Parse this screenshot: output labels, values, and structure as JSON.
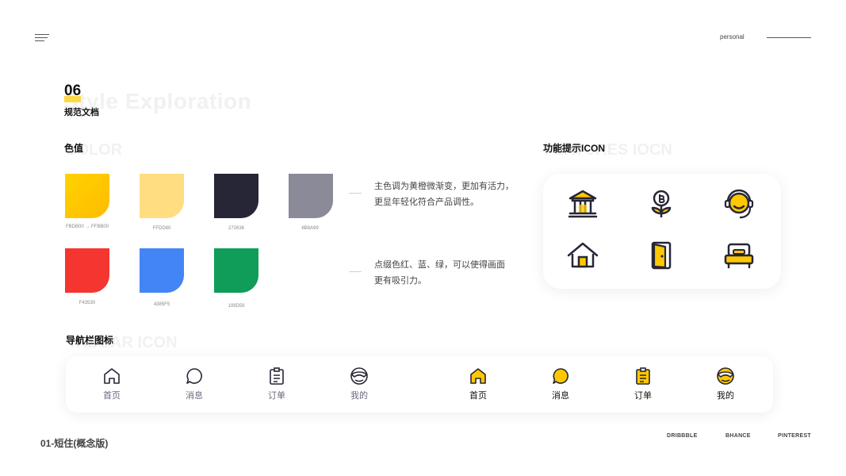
{
  "header": {
    "personal_label": "personal"
  },
  "section": {
    "number": "06",
    "ghost_title": "Style Exploration",
    "title": "规范文档"
  },
  "color": {
    "heading": "色值",
    "ghost": "COLOR",
    "swatches": [
      {
        "label": "FBDB00 → FFBB00",
        "gradient": [
          "#FFD300",
          "#FFBB00"
        ]
      },
      {
        "label": "FFDD80",
        "color": "#FFDD80"
      },
      {
        "label": "272636",
        "color": "#272636"
      },
      {
        "label": "8B8A99",
        "color": "#8B8A99"
      },
      {
        "label": "F43530",
        "color": "#F43530"
      },
      {
        "label": "4385F5",
        "color": "#4385F5"
      },
      {
        "label": "109D59",
        "color": "#109D59"
      }
    ],
    "desc_primary": [
      "主色调为黄橙微渐变，更加有活力，",
      "更显年轻化符合产品调性。"
    ],
    "desc_accent": [
      "点缀色红、蓝、绿，可以使得画面",
      "更有吸引力。"
    ]
  },
  "features": {
    "heading": "功能提示ICON",
    "ghost": "FEATURES IOCN",
    "icons": [
      "bank-icon",
      "coin-plant-icon",
      "customer-service-icon",
      "house-icon",
      "door-icon",
      "bed-icon"
    ]
  },
  "tabbar": {
    "heading": "导航栏图标",
    "ghost": "TABBAR ICON",
    "inactive": [
      "首页",
      "消息",
      "订单",
      "我的"
    ],
    "active": [
      "首页",
      "消息",
      "订单",
      "我的"
    ]
  },
  "footer": {
    "title": "01-短住(概念版)",
    "links": [
      "DRIBBBLE",
      "BHANCE",
      "PINTEREST"
    ]
  },
  "colors": {
    "accent": "#FFC800",
    "dark": "#272636",
    "muted": "#6A6880"
  }
}
